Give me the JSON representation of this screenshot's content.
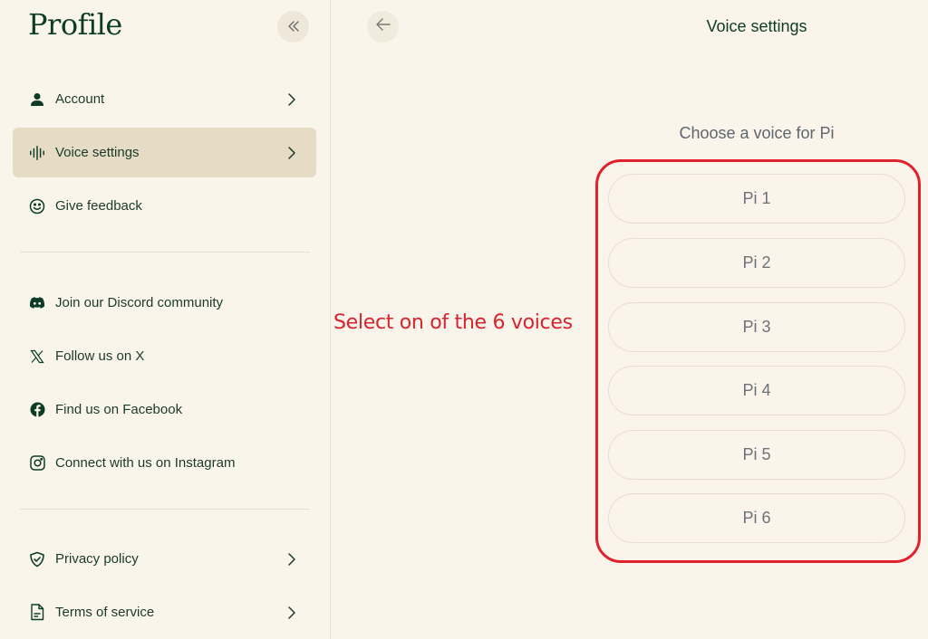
{
  "sidebar": {
    "title": "Profile",
    "collapse_icon": "double-chevron-left-icon",
    "primary_items": [
      {
        "label": "Account",
        "icon": "user-icon",
        "has_chevron": true,
        "active": false
      },
      {
        "label": "Voice settings",
        "icon": "waveform-icon",
        "has_chevron": true,
        "active": true
      },
      {
        "label": "Give feedback",
        "icon": "smiley-icon",
        "has_chevron": false,
        "active": false
      }
    ],
    "social_items": [
      {
        "label": "Join our Discord community",
        "icon": "discord-icon"
      },
      {
        "label": "Follow us on X",
        "icon": "x-logo-icon"
      },
      {
        "label": "Find us on Facebook",
        "icon": "facebook-icon"
      },
      {
        "label": "Connect with us on Instagram",
        "icon": "instagram-icon"
      }
    ],
    "legal_items": [
      {
        "label": "Privacy policy",
        "icon": "shield-check-icon",
        "has_chevron": true
      },
      {
        "label": "Terms of service",
        "icon": "document-icon",
        "has_chevron": true
      }
    ]
  },
  "main": {
    "back_icon": "arrow-left-icon",
    "title": "Voice settings",
    "choose_label": "Choose a voice for Pi",
    "voices": [
      "Pi 1",
      "Pi 2",
      "Pi 3",
      "Pi 4",
      "Pi 5",
      "Pi 6"
    ]
  },
  "annotation": {
    "text": "Select on of the 6 voices",
    "color": "#d9232f"
  },
  "colors": {
    "background": "#faf4ea",
    "active_item": "#e6dbc4",
    "text_primary": "#0d3c26",
    "highlight_border": "#e0222e"
  }
}
